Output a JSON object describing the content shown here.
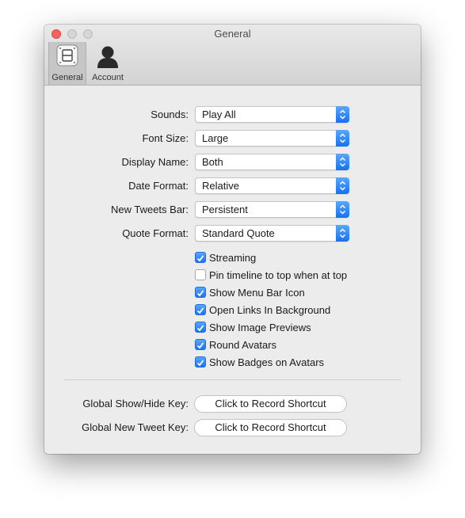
{
  "window": {
    "title": "General",
    "tabs": [
      {
        "label": "General",
        "icon": "general-switch-icon"
      },
      {
        "label": "Account",
        "icon": "account-person-icon"
      }
    ]
  },
  "settings": {
    "popups": [
      {
        "label": "Sounds:",
        "value": "Play All"
      },
      {
        "label": "Font Size:",
        "value": "Large"
      },
      {
        "label": "Display Name:",
        "value": "Both"
      },
      {
        "label": "Date Format:",
        "value": "Relative"
      },
      {
        "label": "New Tweets Bar:",
        "value": "Persistent"
      },
      {
        "label": "Quote Format:",
        "value": "Standard Quote"
      }
    ],
    "checkboxes": [
      {
        "label": "Streaming",
        "checked": true
      },
      {
        "label": "Pin timeline to top when at top",
        "checked": false
      },
      {
        "label": "Show Menu Bar Icon",
        "checked": true
      },
      {
        "label": "Open Links In Background",
        "checked": true
      },
      {
        "label": "Show Image Previews",
        "checked": true
      },
      {
        "label": "Round Avatars",
        "checked": true
      },
      {
        "label": "Show Badges on Avatars",
        "checked": true
      }
    ],
    "shortcuts": [
      {
        "label": "Global Show/Hide Key:",
        "button": "Click to Record Shortcut"
      },
      {
        "label": "Global New Tweet Key:",
        "button": "Click to Record Shortcut"
      }
    ]
  },
  "colors": {
    "accent": "#1b72ee",
    "close_button": "#fc605b"
  }
}
